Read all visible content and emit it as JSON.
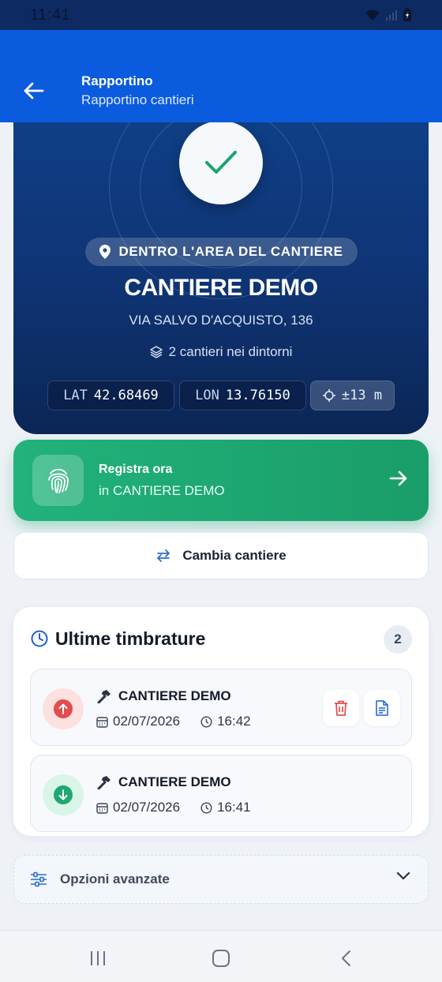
{
  "status_bar": {
    "time": "11:41"
  },
  "app_bar": {
    "title": "Rapportino",
    "subtitle": "Rapportino cantieri"
  },
  "hero": {
    "area_status": "DENTRO L'AREA DEL CANTIERE",
    "site_name": "CANTIERE DEMO",
    "address": "VIA SALVO D'ACQUISTO, 136",
    "nearby": "2 cantieri nei dintorni",
    "lat_label": "LAT",
    "lat_value": "42.68469",
    "lon_label": "LON",
    "lon_value": "13.76150",
    "accuracy": "±13 m"
  },
  "register": {
    "title": "Registra ora",
    "subtitle": "in CANTIERE DEMO"
  },
  "change_site": {
    "label": "Cambia cantiere"
  },
  "recent": {
    "title": "Ultime timbrature",
    "count": "2",
    "entries": [
      {
        "name": "CANTIERE DEMO",
        "date": "02/07/2026",
        "time": "16:42",
        "direction": "out"
      },
      {
        "name": "CANTIERE DEMO",
        "date": "02/07/2026",
        "time": "16:41",
        "direction": "in"
      }
    ]
  },
  "advanced": {
    "label": "Opzioni avanzate"
  },
  "colors": {
    "primary": "#0b5bde",
    "hero": "#0f3f86",
    "success": "#1fa872",
    "danger": "#e24c4c",
    "text": "#141b28"
  }
}
